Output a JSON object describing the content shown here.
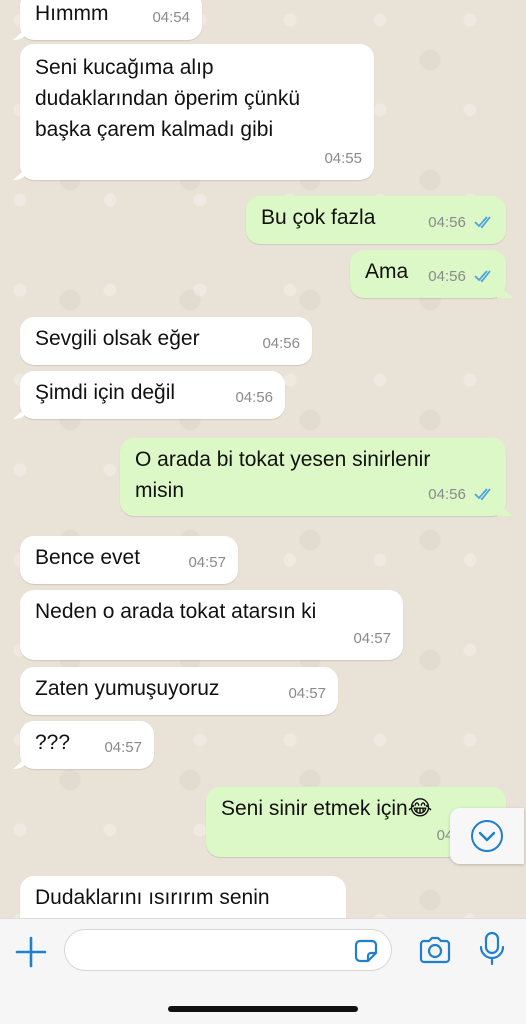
{
  "messages": [
    {
      "dir": "in",
      "text": "Hımmm",
      "time": "04:54"
    },
    {
      "dir": "in",
      "text": "Seni kucağıma alıp\ndudaklarından öperim çünkü\nbaşka çarem kalmadı gibi",
      "time": "04:55"
    },
    {
      "dir": "out",
      "text": "Bu çok fazla",
      "time": "04:56",
      "status": "read"
    },
    {
      "dir": "out",
      "text": "Ama",
      "time": "04:56",
      "status": "read"
    },
    {
      "dir": "in",
      "text": "Sevgili olsak eğer",
      "time": "04:56"
    },
    {
      "dir": "in",
      "text": "Şimdi için değil",
      "time": "04:56"
    },
    {
      "dir": "out",
      "text": "O arada bi tokat yesen sinirlenir\nmisin",
      "time": "04:56",
      "status": "read"
    },
    {
      "dir": "in",
      "text": "Bence evet",
      "time": "04:57"
    },
    {
      "dir": "in",
      "text": "Neden o arada tokat atarsın ki",
      "time": "04:57"
    },
    {
      "dir": "in",
      "text": "Zaten yumuşuyoruz",
      "time": "04:57"
    },
    {
      "dir": "in",
      "text": "???",
      "time": "04:57"
    },
    {
      "dir": "out",
      "text": "Seni sinir etmek için😂",
      "time": "04:5",
      "status": "read"
    },
    {
      "dir": "in",
      "text": "Dudaklarını ısırırım senin",
      "time": ""
    }
  ],
  "composer": {
    "placeholder": ""
  },
  "icons": {
    "attach": "plus-icon",
    "sticker": "sticker-icon",
    "camera": "camera-icon",
    "mic": "microphone-icon",
    "scroll": "chevron-down-icon",
    "read": "double-check-icon"
  },
  "colors": {
    "incoming_bubble": "#ffffff",
    "outgoing_bubble": "#dcf8c6",
    "accent": "#1f7fd0",
    "read_ticks": "#4fa3e0"
  }
}
